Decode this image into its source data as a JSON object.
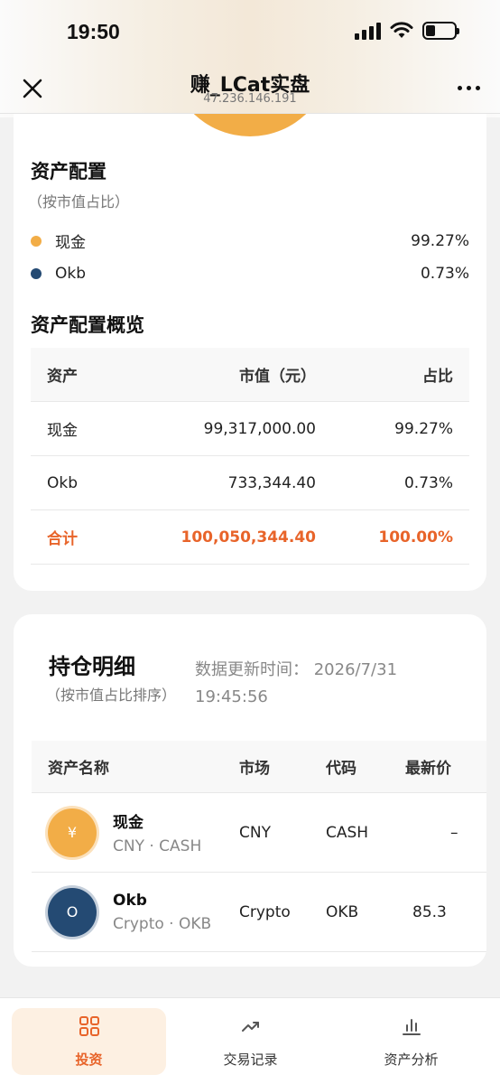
{
  "status": {
    "time": "19:50"
  },
  "nav": {
    "title": "赚_LCat实盘",
    "subtitle": "47.236.146.191"
  },
  "allocation": {
    "title": "资产配置",
    "subtitle": "（按市值占比）",
    "legend": [
      {
        "name": "现金",
        "value": "99.27%",
        "color": "#f2ad47"
      },
      {
        "name": "Okb",
        "value": "0.73%",
        "color": "#244a73"
      }
    ]
  },
  "overview": {
    "title": "资产配置概览",
    "headers": [
      "资产",
      "市值（元）",
      "占比"
    ],
    "rows": [
      [
        "现金",
        "99,317,000.00",
        "99.27%"
      ],
      [
        "Okb",
        "733,344.40",
        "0.73%"
      ]
    ],
    "total": [
      "合计",
      "100,050,344.40",
      "100.00%"
    ]
  },
  "holdings": {
    "title": "持仓明细",
    "subtitle": "（按市值占比排序）",
    "updated_label": "数据更新时间：",
    "updated_value": "2026/7/31 19:45:56",
    "headers": [
      "资产名称",
      "市场",
      "代码",
      "最新价"
    ],
    "rows": [
      {
        "icon": "¥",
        "name": "现金",
        "sub": "CNY · CASH",
        "market": "CNY",
        "code": "CASH",
        "price": "–"
      },
      {
        "icon": "O",
        "name": "Okb",
        "sub": "Crypto · OKB",
        "market": "Crypto",
        "code": "OKB",
        "price": "85.3"
      }
    ]
  },
  "tabs": [
    {
      "label": "投资",
      "icon": "grid-icon"
    },
    {
      "label": "交易记录",
      "icon": "trend-icon"
    },
    {
      "label": "资产分析",
      "icon": "bar-chart-icon"
    }
  ],
  "colors": {
    "accent": "#e8642a",
    "cash": "#f2ad47",
    "okb": "#244a73"
  }
}
